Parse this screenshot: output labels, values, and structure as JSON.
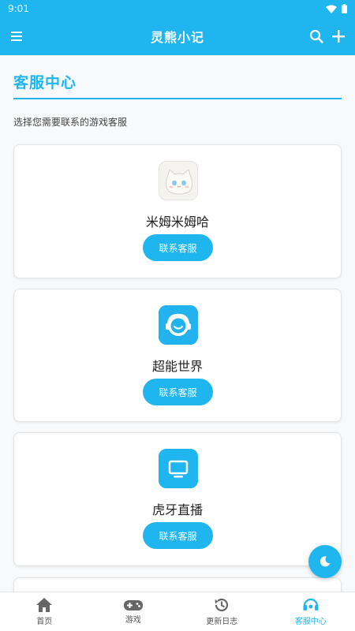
{
  "status": {
    "time": "9:01"
  },
  "header": {
    "title": "灵熊小记"
  },
  "section": {
    "title": "客服中心",
    "subtitle": "选择您需要联系的游戏客服"
  },
  "games": [
    {
      "name": "米姆米姆哈",
      "button_label": "联系客服"
    },
    {
      "name": "超能世界",
      "button_label": "联系客服"
    },
    {
      "name": "虎牙直播",
      "button_label": "联系客服"
    }
  ],
  "bottom_nav": [
    {
      "label": "首页",
      "icon": "home-icon"
    },
    {
      "label": "游戏",
      "icon": "gamepad-icon"
    },
    {
      "label": "更新日志",
      "icon": "history-icon"
    },
    {
      "label": "客服中心",
      "icon": "headset-icon",
      "active": true
    }
  ],
  "colors": {
    "accent": "#1fb6f0",
    "background": "#f8f9fa"
  }
}
